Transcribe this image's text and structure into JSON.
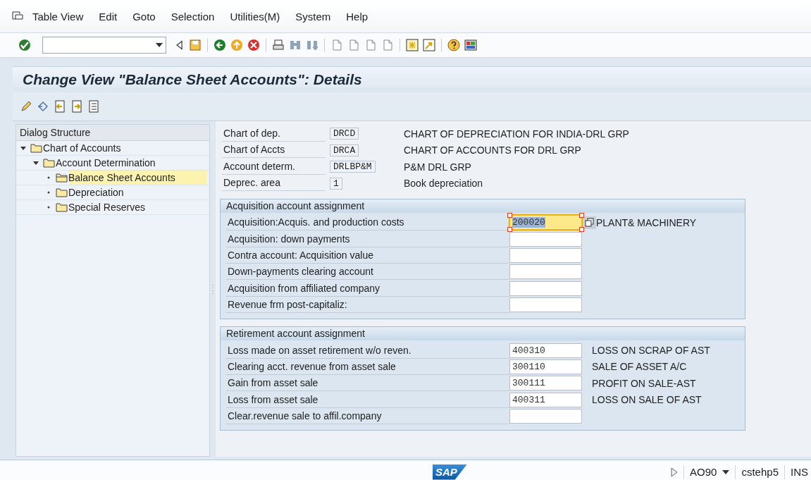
{
  "menu_bar": {
    "items": [
      "Table View",
      "Edit",
      "Goto",
      "Selection",
      "Utilities(M)",
      "System",
      "Help"
    ]
  },
  "title": "Change View \"Balance Sheet Accounts\": Details",
  "dialog_structure": {
    "title": "Dialog Structure",
    "items": [
      {
        "label": "Chart of Accounts",
        "expanded": true,
        "selected": false,
        "children": [
          {
            "label": "Account Determination",
            "expanded": true,
            "selected": false,
            "children": [
              {
                "label": "Balance Sheet Accounts",
                "selected": true
              },
              {
                "label": "Depreciation",
                "selected": false
              },
              {
                "label": "Special Reserves",
                "selected": false
              }
            ]
          }
        ]
      }
    ]
  },
  "header_fields": [
    {
      "label": "Chart of dep.",
      "value": "DRCD",
      "description": "CHART OF DEPRECIATION FOR INDIA-DRL GRP"
    },
    {
      "label": "Chart of Accts",
      "value": "DRCA",
      "description": "CHART OF ACCOUNTS FOR DRL GRP"
    },
    {
      "label": "Account determ.",
      "value": "DRLBP&M",
      "description": "P&M DRL GRP"
    },
    {
      "label": "Deprec. area",
      "value": "1",
      "description": "Book depreciation"
    }
  ],
  "sections": [
    {
      "title": "Acquisition account assignment",
      "rows": [
        {
          "label": "Acquisition:Acquis. and production costs",
          "value": "200020",
          "description": "PLANT& MACHINERY",
          "focused": true
        },
        {
          "label": "Acquisition: down payments",
          "focused": false
        },
        {
          "label": "Contra account: Acquisition value",
          "focused": false
        },
        {
          "label": "Down-payments clearing account",
          "focused": false
        },
        {
          "label": "Acquisition from affiliated company",
          "focused": false
        },
        {
          "label": "Revenue frm post-capitaliz:",
          "focused": false
        }
      ]
    },
    {
      "title": "Retirement account assignment",
      "rows": [
        {
          "label": "Loss made on asset retirement w/o reven.",
          "value": "400310",
          "description": "LOSS ON SCRAP OF AST",
          "focused": false
        },
        {
          "label": "Clearing acct. revenue from asset sale",
          "value": "300110",
          "description": "SALE OF ASSET A/C",
          "focused": false
        },
        {
          "label": "Gain from asset sale",
          "value": "300111",
          "description": "PROFIT ON SALE-AST",
          "focused": false
        },
        {
          "label": "Loss from asset sale",
          "value": "400311",
          "description": "LOSS ON SALE OF AST",
          "focused": false
        },
        {
          "label": "Clear.revenue sale to affil.company",
          "focused": false
        }
      ]
    }
  ],
  "status_bar": {
    "logo": "SAP",
    "transaction": "AO90",
    "server": "cstehp5",
    "mode": "INS"
  }
}
